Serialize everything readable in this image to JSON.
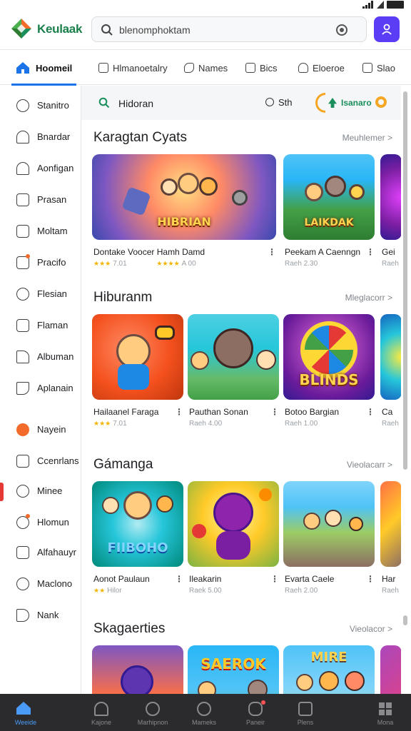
{
  "header": {
    "brand": "Keulaak",
    "search_value": "blenomphoktam",
    "colors": {
      "brand": "#1a7f4b",
      "accent": "#5b3df5"
    }
  },
  "toptabs": [
    {
      "label": "Hoomeil",
      "icon": "home-icon",
      "active": true
    },
    {
      "label": "Hlmanoetalry",
      "icon": "document-icon"
    },
    {
      "label": "Names",
      "icon": "tag-icon"
    },
    {
      "label": "Bics",
      "icon": "monitor-icon"
    },
    {
      "label": "Eloeroe",
      "icon": "flag-icon"
    },
    {
      "label": "Slao",
      "icon": "gift-icon"
    }
  ],
  "sidebar": {
    "items": [
      {
        "label": "Stanitro",
        "icon": "compass-icon"
      },
      {
        "label": "Bnardar",
        "icon": "bell-icon"
      },
      {
        "label": "Aonfigan",
        "icon": "bell-icon"
      },
      {
        "label": "Prasan",
        "icon": "document-icon"
      },
      {
        "label": "Moltam",
        "icon": "document-icon"
      },
      {
        "label": "Pracifo",
        "icon": "notebook-icon"
      },
      {
        "label": "Flesian",
        "icon": "paperclip-icon"
      },
      {
        "label": "Flaman",
        "icon": "notebook-icon"
      },
      {
        "label": "Albuman",
        "icon": "home-icon"
      },
      {
        "label": "Aplanain",
        "icon": "tag-icon"
      },
      {
        "label": "Nayein",
        "icon": "orange-app-icon"
      },
      {
        "label": "Ccenrlans",
        "icon": "list-icon"
      },
      {
        "label": "Minee",
        "icon": "chat-icon"
      },
      {
        "label": "Hlomun",
        "icon": "user-icon"
      },
      {
        "label": "Alfahauyr",
        "icon": "folder-icon"
      },
      {
        "label": "Maclono",
        "icon": "clock-icon"
      },
      {
        "label": "Nank",
        "icon": "flag-icon"
      }
    ]
  },
  "filterbar": {
    "label": "Hidoran",
    "sth_label": "Sth",
    "chip_label": "Isanaro"
  },
  "sections": [
    {
      "title": "Karagtan Cyats",
      "more": "Meuhlemer >",
      "cards": [
        {
          "title": "Dontake Voocer  Hamh Damd",
          "meta": "7.01",
          "stars": "★★★",
          "meta2": "A 00",
          "stars2": "★★★★",
          "art": "HIBRIAN"
        },
        {
          "title": "Peekam A Caenngn",
          "meta": "Raeh 2.30",
          "art": "LAIKDAK"
        },
        {
          "title": "Gei",
          "meta": "Raeh",
          "art": ""
        }
      ]
    },
    {
      "title": "Hiburanm",
      "more": "Mleglacorr >",
      "cards": [
        {
          "title": "Hailaanel Faraga",
          "meta": "7.01",
          "stars": "★★★",
          "art": ""
        },
        {
          "title": "Pauthan Sonan",
          "meta": "Raeh 4.00",
          "art": ""
        },
        {
          "title": "Botoo Bargian",
          "meta": "Raeh 1.00",
          "art": "BLINDS"
        },
        {
          "title": "Ca",
          "meta": "Raeh",
          "art": ""
        }
      ]
    },
    {
      "title": "Gámanga",
      "more": "Vieolacarr >",
      "cards": [
        {
          "title": "Aonot Paulaun",
          "meta": "Hilor",
          "stars": "★★",
          "art": "FIIBOHO"
        },
        {
          "title": "Ileakarin",
          "meta": "Raek 5.00",
          "art": ""
        },
        {
          "title": "Evarta Caele",
          "meta": "Raeh 2.00",
          "art": ""
        },
        {
          "title": "Har",
          "meta": "Raeh",
          "art": ""
        }
      ]
    },
    {
      "title": "Skagaerties",
      "more": "Vieolacor >",
      "cards": [
        {
          "title": "",
          "meta": "",
          "art": ""
        },
        {
          "title": "",
          "meta": "",
          "art": "SAEROK"
        },
        {
          "title": "",
          "meta": "",
          "art": "MIRE"
        },
        {
          "title": "",
          "meta": "",
          "art": ""
        }
      ]
    }
  ],
  "bottomnav": [
    {
      "label": "Weeide",
      "icon": "home-icon",
      "active": true
    },
    {
      "label": "Kajone",
      "icon": "home-outline-icon"
    },
    {
      "label": "Marhipnon",
      "icon": "clock-icon"
    },
    {
      "label": "Mameks",
      "icon": "compass-icon"
    },
    {
      "label": "Paneir",
      "icon": "camera-icon",
      "badge": true
    },
    {
      "label": "Plens",
      "icon": "square-icon"
    },
    {
      "label": "Mona",
      "icon": "grid-icon"
    }
  ]
}
